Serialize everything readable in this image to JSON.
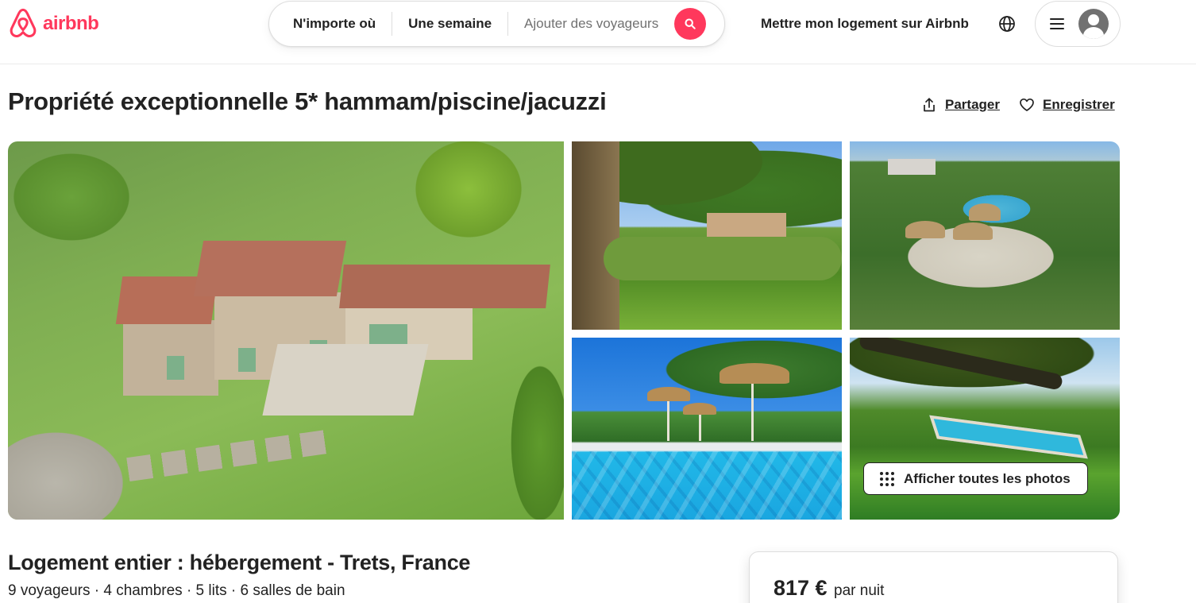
{
  "header": {
    "logo_text": "airbnb",
    "search": {
      "where": "N'importe où",
      "when": "Une semaine",
      "guests_placeholder": "Ajouter des voyageurs"
    },
    "host_link": "Mettre mon logement sur Airbnb"
  },
  "listing": {
    "title": "Propriété exceptionnelle 5* hammam/piscine/jacuzzi",
    "actions": {
      "share": "Partager",
      "save": "Enregistrer"
    },
    "show_all_photos": "Afficher toutes les photos",
    "subtitle": "Logement entier : hébergement - Trets, France",
    "details": "9 voyageurs · 4 chambres · 5 lits · 6 salles de bain"
  },
  "booking": {
    "price": "817 €",
    "price_unit": "par nuit"
  },
  "colors": {
    "brand": "#ff385c",
    "text": "#222222",
    "muted": "#717171",
    "border": "#dddddd"
  },
  "icons": [
    "airbnb-logo-icon",
    "search-icon",
    "globe-icon",
    "hamburger-menu-icon",
    "user-avatar-icon",
    "share-icon",
    "heart-icon",
    "grid-dots-icon"
  ]
}
